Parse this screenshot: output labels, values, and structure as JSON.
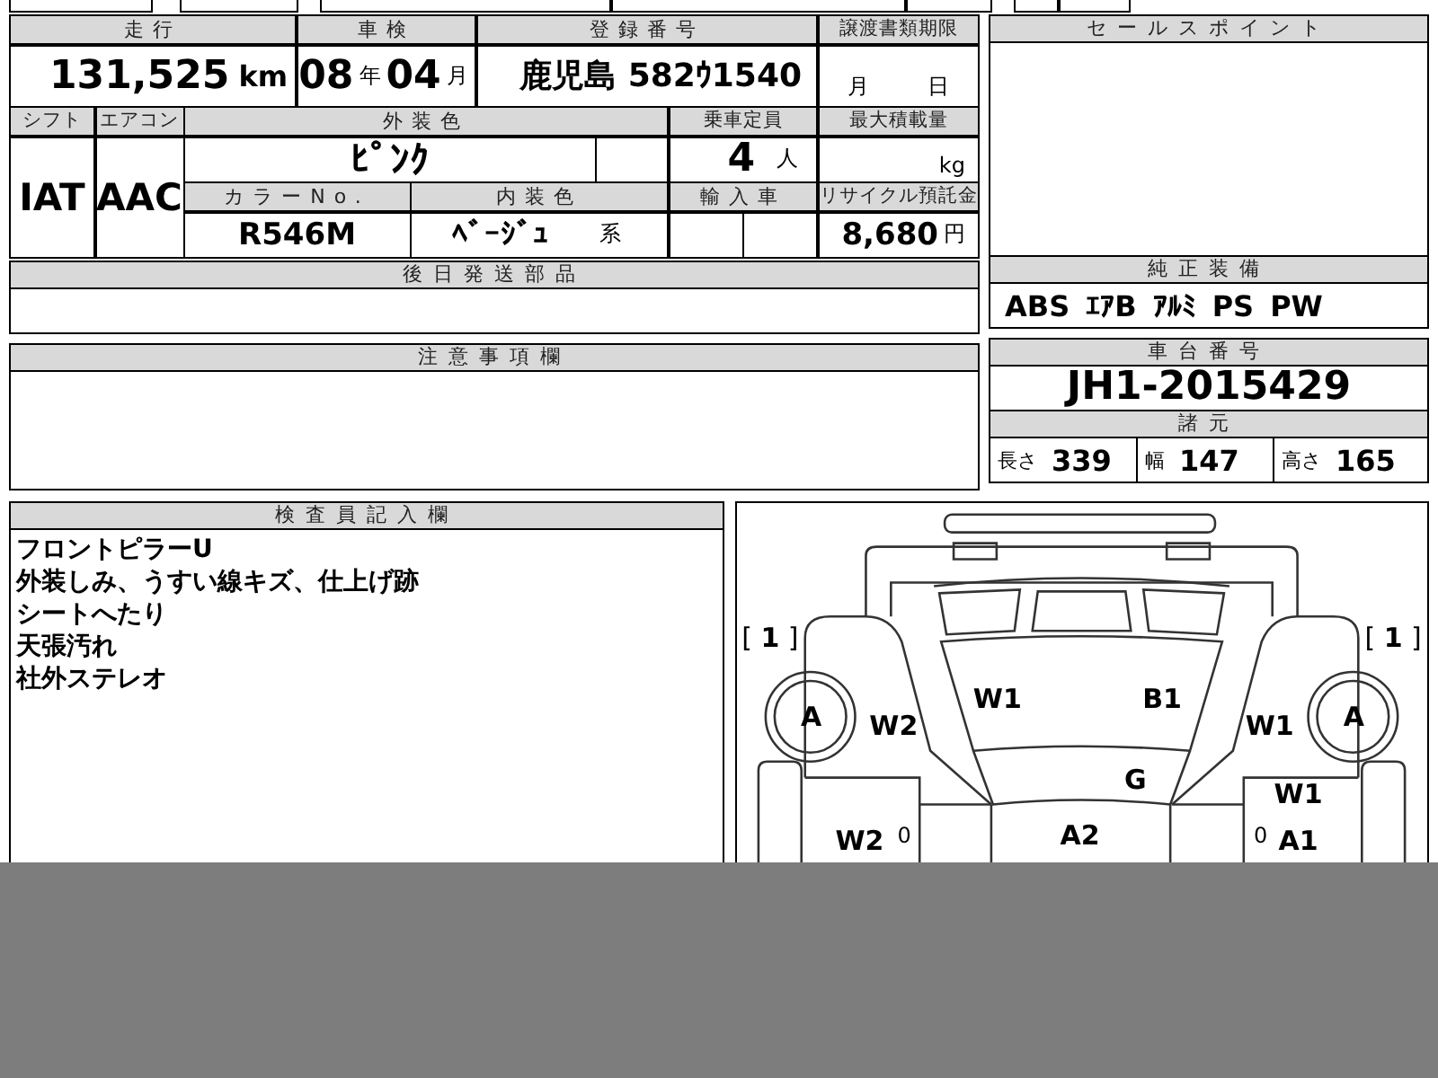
{
  "vehicle_table": {
    "mileage": {
      "label": "走行",
      "value": "131,525",
      "unit": "km"
    },
    "inspection": {
      "label": "車検",
      "year": "08",
      "year_unit": "年",
      "month": "04",
      "month_unit": "月"
    },
    "registration": {
      "label": "登録番号",
      "value": "鹿児島 582ｳ1540"
    },
    "transfer_deadline": {
      "label": "譲渡書類期限",
      "month_unit": "月",
      "day_unit": "日"
    },
    "shift": {
      "label": "シフト",
      "value": "IAT"
    },
    "aircon": {
      "label": "エアコン",
      "value": "AAC"
    },
    "exterior_color": {
      "label": "外装色",
      "value": "ﾋﾟﾝｸ"
    },
    "capacity": {
      "label": "乗車定員",
      "value": "4",
      "unit": "人"
    },
    "max_load": {
      "label": "最大積載量",
      "unit": "kg"
    },
    "color_no": {
      "label": "カラーNo.",
      "value": "R546M"
    },
    "interior_color": {
      "label": "内装色",
      "value": "ﾍﾞｰｼﾞｭ",
      "suffix": "系"
    },
    "imported": {
      "label": "輸入車"
    },
    "recycle_fee": {
      "label": "リサイクル預託金",
      "value": "8,680",
      "unit": "円"
    }
  },
  "later_parts": {
    "label": "後日発送部品"
  },
  "notices": {
    "label": "注意事項欄"
  },
  "sales_points": {
    "label": "セールスポイント"
  },
  "equipment": {
    "label": "純正装備",
    "items": [
      "ABS",
      "ｴｱB",
      "ｱﾙﾐ",
      "PS",
      "PW"
    ]
  },
  "chassis": {
    "label": "車台番号",
    "value": "JH1-2015429"
  },
  "specs": {
    "label": "諸元",
    "items": [
      {
        "label": "長さ",
        "value": "339"
      },
      {
        "label": "幅",
        "value": "147"
      },
      {
        "label": "高さ",
        "value": "165"
      }
    ]
  },
  "inspector_notes": {
    "label": "検査員記入欄",
    "lines": [
      "フロントピラーU",
      "外装しみ、うすい線キズ、仕上げ跡",
      "シートへたり",
      "天張汚れ",
      "社外ステレオ"
    ]
  },
  "diagram": {
    "marks": [
      {
        "text": "[ **1** ]"
      },
      {
        "text": "[ **1** ]"
      },
      {
        "text": "A"
      },
      {
        "text": "W1"
      },
      {
        "text": "B1"
      },
      {
        "text": "A"
      },
      {
        "text": "W2"
      },
      {
        "text": "W1"
      },
      {
        "text": "G"
      },
      {
        "text": "W1"
      },
      {
        "text": "W2"
      },
      {
        "text": "0"
      },
      {
        "text": "A2"
      },
      {
        "text": "0"
      },
      {
        "text": "A1"
      }
    ]
  }
}
